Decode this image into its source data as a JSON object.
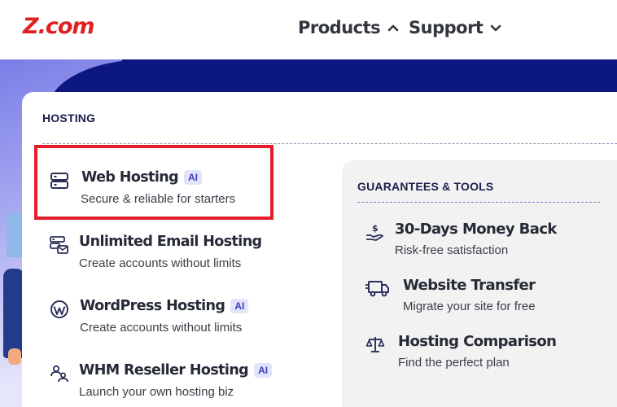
{
  "header": {
    "logo": "Z.com",
    "nav": [
      {
        "label": "Products",
        "icon": "chevron-up-icon"
      },
      {
        "label": "Support",
        "icon": "chevron-down-icon"
      }
    ]
  },
  "hosting": {
    "title": "HOSTING",
    "items": [
      {
        "title": "Web Hosting",
        "badge": "AI",
        "desc": "Secure & reliable for starters",
        "icon": "server-icon",
        "highlighted": true
      },
      {
        "title": "Unlimited Email Hosting",
        "badge": "",
        "desc": "Create accounts without limits",
        "icon": "email-server-icon"
      },
      {
        "title": "WordPress Hosting",
        "badge": "AI",
        "desc": "Create accounts without limits",
        "icon": "wordpress-icon"
      },
      {
        "title": "WHM Reseller Hosting",
        "badge": "AI",
        "desc": "Launch your own hosting biz",
        "icon": "reseller-users-icon"
      }
    ]
  },
  "tools": {
    "title": "GUARANTEES & TOOLS",
    "items": [
      {
        "title": "30-Days Money Back",
        "desc": "Risk-free satisfaction",
        "icon": "money-back-icon"
      },
      {
        "title": "Website Transfer",
        "desc": "Migrate your site for free",
        "icon": "transfer-truck-icon"
      },
      {
        "title": "Hosting Comparison",
        "desc": "Find the perfect plan",
        "icon": "scale-icon"
      }
    ]
  },
  "colors": {
    "brand": "#e02020",
    "navy": "#0d1781",
    "highlight": "#e31c2a",
    "badge_bg": "#e3e4fb"
  }
}
